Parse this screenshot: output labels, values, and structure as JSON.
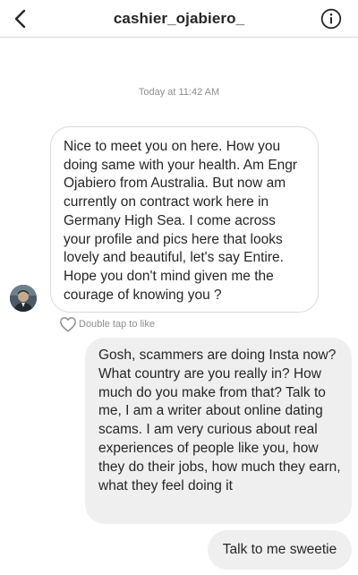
{
  "header": {
    "username": "cashier_ojabiero_",
    "back_icon": "chevron-left-icon",
    "info_icon": "info-circle-icon"
  },
  "thread": {
    "timestamp": "Today at 11:42 AM",
    "incoming": {
      "text": "Nice to meet you on here.  How you doing same with your health. Am Engr Ojabiero from Australia. But now am currently on contract work here in Germany High Sea. I come across your profile and pics here that looks lovely and beautiful, let's say Entire. Hope you don't mind given me the courage of knowing you ?",
      "like_hint": "Double tap to like"
    },
    "outgoing": [
      {
        "text": "Gosh, scammers are doing Insta now? What country are you really in? How much do you make from that? Talk to me, I am a writer about online dating scams. I am very curious about real experiences of people like you, how they do their jobs, how much they earn, what they feel doing it"
      },
      {
        "text": "Talk to me sweetie"
      }
    ]
  },
  "colors": {
    "incoming_border": "#dbdbdb",
    "outgoing_bg": "#efefef",
    "text": "#262626",
    "muted": "#8e8e8e"
  }
}
